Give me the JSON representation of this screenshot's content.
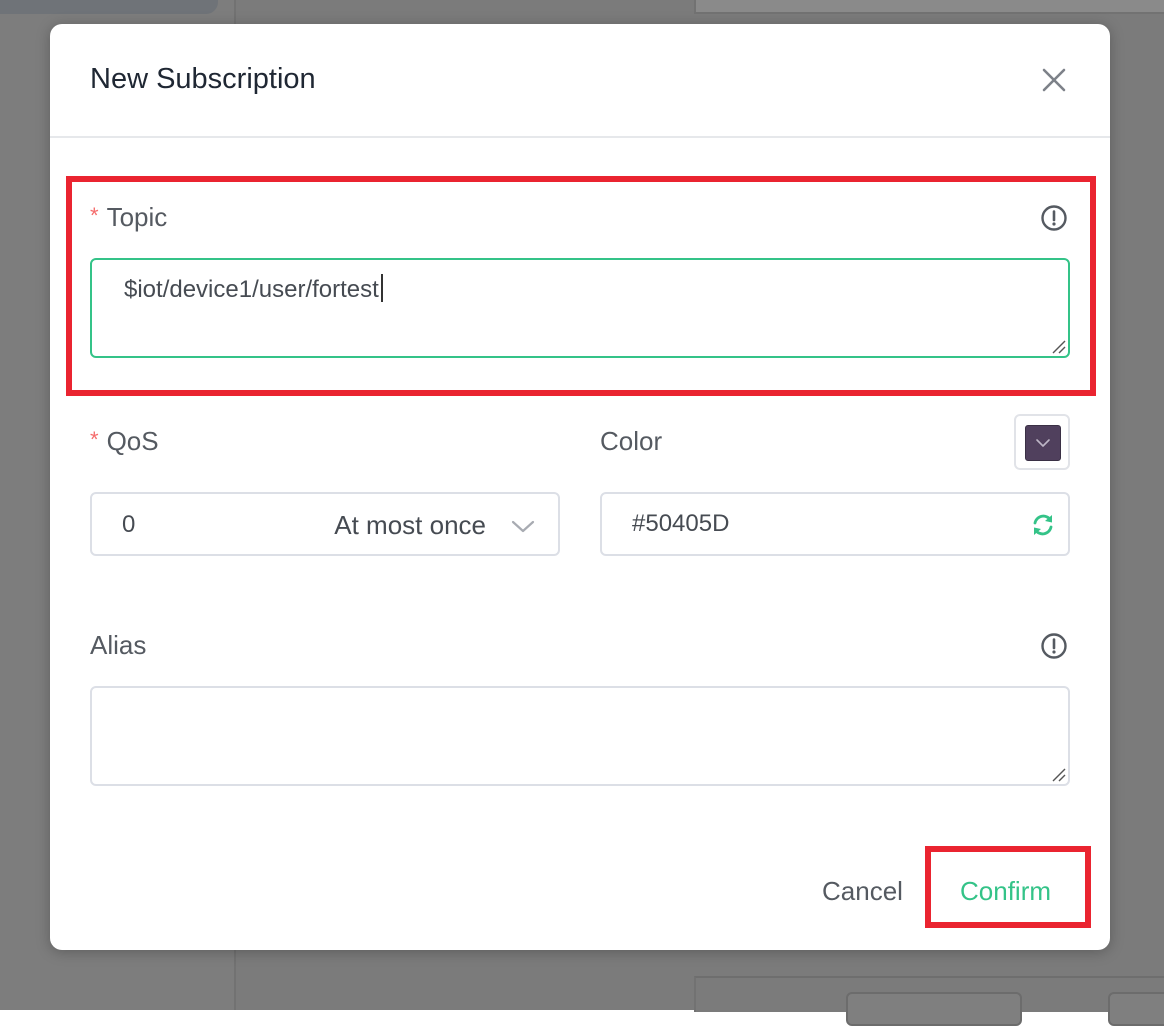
{
  "dialog": {
    "title": "New Subscription",
    "close_icon": "close-icon"
  },
  "topic": {
    "required_mark": "*",
    "label": "Topic",
    "value": "$iot/device1/user/fortest",
    "info_icon": "info-circle-icon"
  },
  "qos": {
    "required_mark": "*",
    "label": "QoS",
    "value": "0",
    "description": "At most once",
    "chevron_icon": "chevron-down-icon"
  },
  "color": {
    "label": "Color",
    "value": "#50405D",
    "swatch_color": "#50405D",
    "refresh_icon": "refresh-icon"
  },
  "alias": {
    "label": "Alias",
    "value": "",
    "info_icon": "info-circle-icon"
  },
  "footer": {
    "cancel_label": "Cancel",
    "confirm_label": "Confirm"
  },
  "colors": {
    "accent": "#34C388",
    "highlight": "#EA2430",
    "required": "#F56C6C"
  }
}
